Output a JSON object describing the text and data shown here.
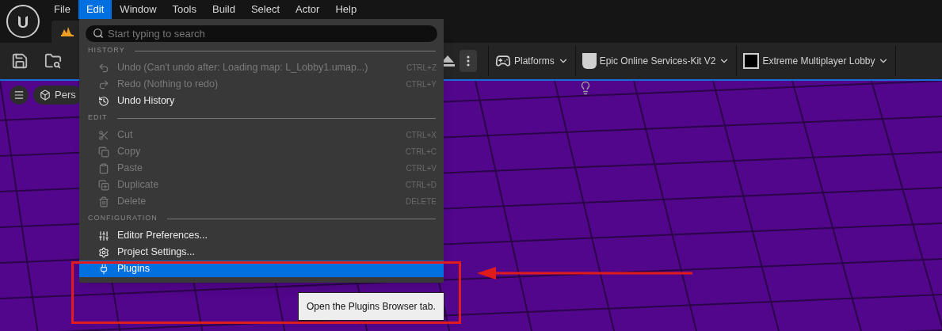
{
  "menubar": [
    {
      "label": "File",
      "selected": false
    },
    {
      "label": "Edit",
      "selected": true
    },
    {
      "label": "Window",
      "selected": false
    },
    {
      "label": "Tools",
      "selected": false
    },
    {
      "label": "Build",
      "selected": false
    },
    {
      "label": "Select",
      "selected": false
    },
    {
      "label": "Actor",
      "selected": false
    },
    {
      "label": "Help",
      "selected": false
    }
  ],
  "toolbar": {
    "buttons": [
      {
        "label": "Platforms"
      },
      {
        "label": "Epic Online Services-Kit V2"
      },
      {
        "label": "Extreme Multiplayer Lobby"
      }
    ]
  },
  "viewport": {
    "view_button": "Pers"
  },
  "edit_menu": {
    "search": {
      "placeholder": "Start typing to search"
    },
    "sections": [
      {
        "title": "HISTORY",
        "items": [
          {
            "label": "Undo (Can't undo after: Loading map: L_Lobby1.umap...)",
            "shortcut": "CTRL+Z",
            "disabled": true,
            "selected": false
          },
          {
            "label": "Redo (Nothing to redo)",
            "shortcut": "CTRL+Y",
            "disabled": true,
            "selected": false
          },
          {
            "label": "Undo History",
            "disabled": false,
            "selected": false
          }
        ]
      },
      {
        "title": "EDIT",
        "items": [
          {
            "label": "Cut",
            "shortcut": "CTRL+X",
            "disabled": true,
            "selected": false
          },
          {
            "label": "Copy",
            "shortcut": "CTRL+C",
            "disabled": true,
            "selected": false
          },
          {
            "label": "Paste",
            "shortcut": "CTRL+V",
            "disabled": true,
            "selected": false
          },
          {
            "label": "Duplicate",
            "shortcut": "CTRL+D",
            "disabled": true,
            "selected": false
          },
          {
            "label": "Delete",
            "shortcut": "DELETE",
            "disabled": true,
            "selected": false
          }
        ]
      },
      {
        "title": "CONFIGURATION",
        "items": [
          {
            "label": "Editor Preferences...",
            "disabled": false,
            "selected": false
          },
          {
            "label": "Project Settings...",
            "disabled": false,
            "selected": false
          },
          {
            "label": "Plugins",
            "disabled": false,
            "selected": true
          }
        ]
      }
    ]
  },
  "tooltip": "Open the Plugins Browser tab."
}
